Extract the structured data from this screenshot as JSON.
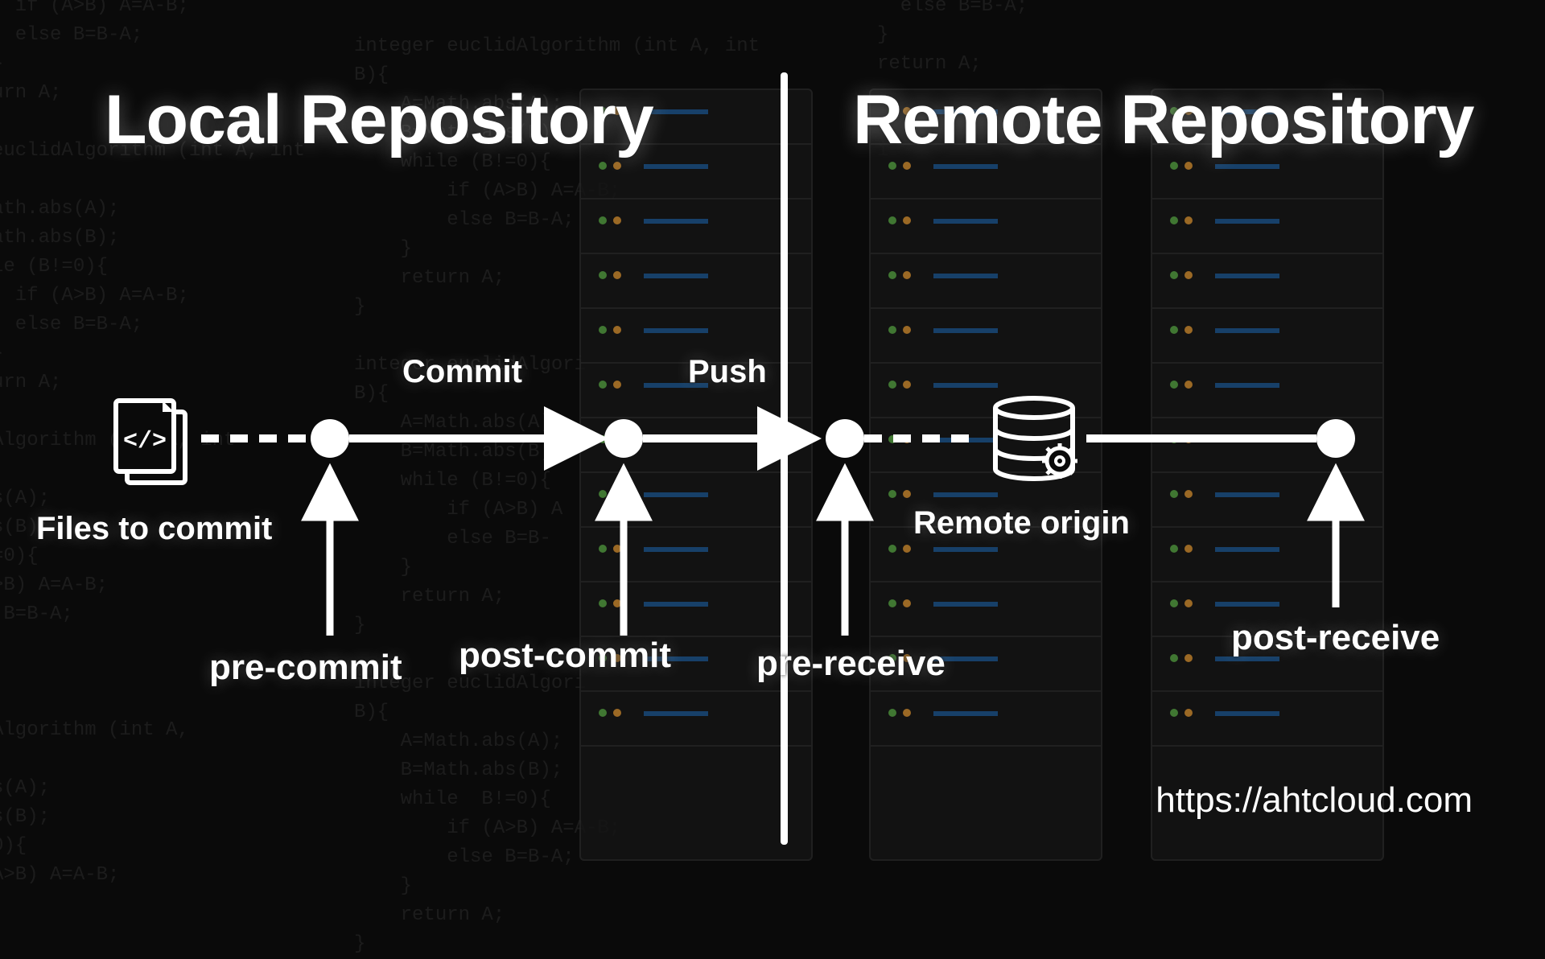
{
  "headings": {
    "local": "Local Repository",
    "remote": "Remote Repository"
  },
  "flow": {
    "commit": "Commit",
    "push": "Push",
    "files_label": "Files to commit",
    "remote_origin": "Remote origin"
  },
  "hooks": {
    "pre_commit": "pre-commit",
    "post_commit": "post-commit",
    "pre_receive": "pre-receive",
    "post_receive": "post-receive"
  },
  "url": "https://ahtcloud.com",
  "code_sample": "  if (A>B) A=A-B;\n  else B=B-A;\n}\nurn A;\n\neuclidAlgorithm (int A, int\n\nath.abs(A);\nath.abs(B);\nle (B!=0){\n  if (A>B) A=A-B;\n  else B=B-A;\n}\nurn A;\n\nAlgorithm (int A, int\n\ns(A);\ns(B);\n=0){\n>B) A=A-B;\n B=B-A;\n\n\n\nAlgorithm (int A,\n\ns(A);\ns(B);\n0){\nA>B) A=A-B;",
  "code_sample2": "integer euclidAlgorithm (int A, int\nB){\n    A=Math.abs(A);\n    B=Math.abs(B);\n    while (B!=0){\n        if (A>B) A=A-B;\n        else B=B-A;\n    }\n    return A;\n}\n\ninteger euclidAlgori\nB){\n    A=Math.abs(A);\n    B=Math.abs(B);\n    while (B!=0){\n        if (A>B) A\n        else B=B-\n    }\n    return A;\n}\n\ninteger euclidAlgori\nB){\n    A=Math.abs(A);\n    B=Math.abs(B);\n    while  B!=0){\n        if (A>B) A=A-B;\n        else B=B-A;\n    }\n    return A;\n}",
  "code_sample3": "  else B=B-A;\n}\nreturn A;\n\n\ni"
}
